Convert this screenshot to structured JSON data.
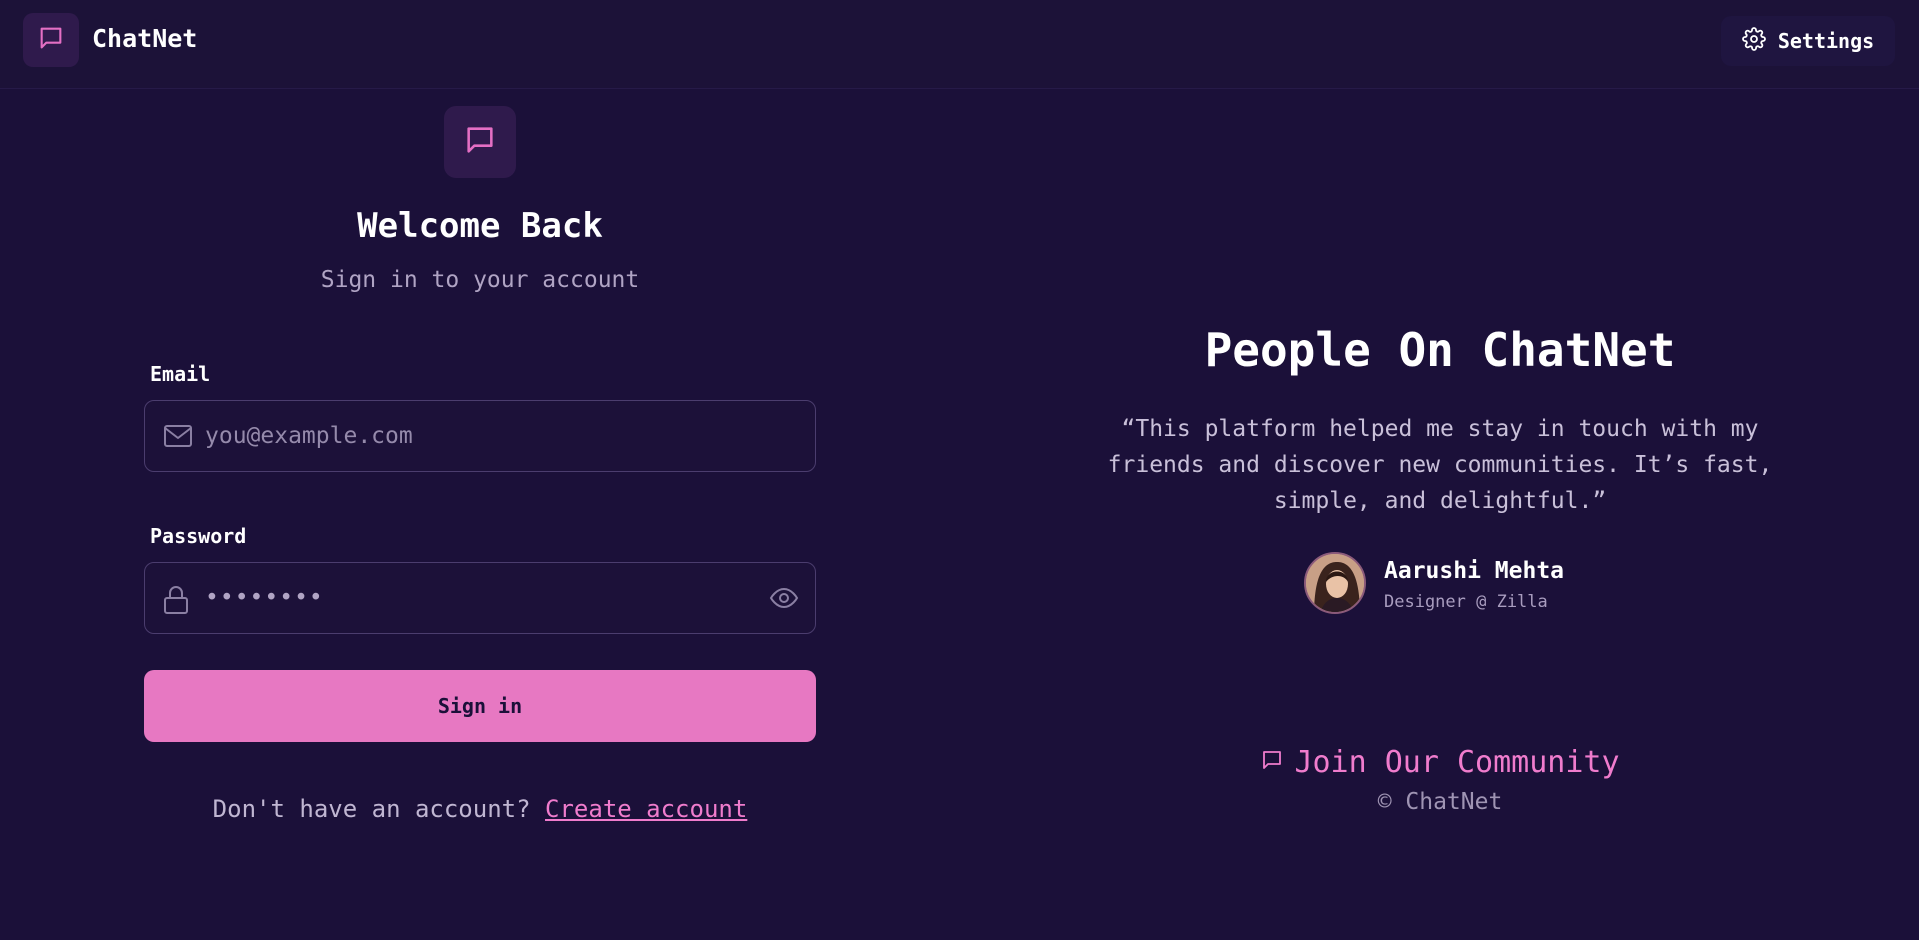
{
  "header": {
    "brand": "ChatNet",
    "settings_label": "Settings",
    "logo_icon": "message-square-icon",
    "settings_icon": "gear-icon"
  },
  "login": {
    "logo_icon": "message-square-icon",
    "title": "Welcome Back",
    "subtitle": "Sign in to your account",
    "email": {
      "label": "Email",
      "placeholder": "you@example.com",
      "value": "",
      "icon": "mail-icon"
    },
    "password": {
      "label": "Password",
      "value": "••••••••",
      "icon": "lock-icon",
      "toggle_icon": "eye-icon"
    },
    "submit_label": "Sign in",
    "signup_prompt": "Don't have an account?",
    "signup_link": "Create account"
  },
  "testimonial": {
    "title": "People On ChatNet",
    "quote": "“This platform helped me stay in touch with my friends and discover new communities. It’s fast, simple, and delightful.”",
    "author_name": "Aarushi Mehta",
    "author_role": "Designer @ Zilla",
    "community_label": "Join Our Community",
    "community_icon": "message-square-icon",
    "copyright": "© ChatNet"
  },
  "colors": {
    "background": "#1b1039",
    "accent": "#e778c2",
    "link": "#f07ccd"
  }
}
